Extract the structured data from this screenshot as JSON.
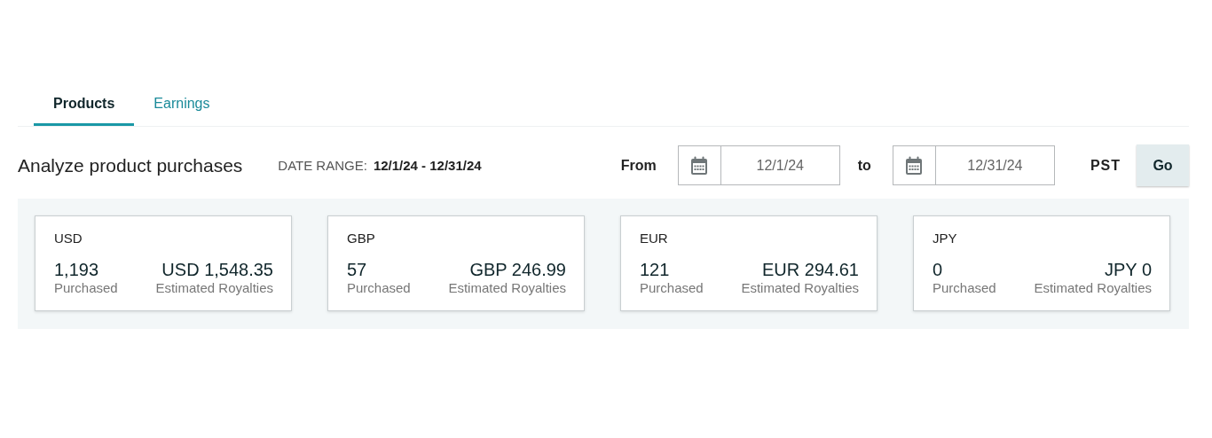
{
  "tabs": [
    {
      "label": "Products",
      "selected": true
    },
    {
      "label": "Earnings",
      "selected": false
    }
  ],
  "heading": "Analyze product purchases",
  "date_range": {
    "label": "DATE RANGE:",
    "value": "12/1/24 - 12/31/24"
  },
  "filter": {
    "from_label": "From",
    "from_value": "12/1/24",
    "to_label": "to",
    "to_value": "12/31/24",
    "timezone": "PST",
    "button": "Go"
  },
  "cards": [
    {
      "currency": "USD",
      "purchased": "1,193",
      "purchased_label": "Purchased",
      "royalties": "USD 1,548.35",
      "royalties_label": "Estimated Royalties"
    },
    {
      "currency": "GBP",
      "purchased": "57",
      "purchased_label": "Purchased",
      "royalties": "GBP 246.99",
      "royalties_label": "Estimated Royalties"
    },
    {
      "currency": "EUR",
      "purchased": "121",
      "purchased_label": "Purchased",
      "royalties": "EUR 294.61",
      "royalties_label": "Estimated Royalties"
    },
    {
      "currency": "JPY",
      "purchased": "0",
      "purchased_label": "Purchased",
      "royalties": "JPY 0",
      "royalties_label": "Estimated Royalties"
    }
  ]
}
